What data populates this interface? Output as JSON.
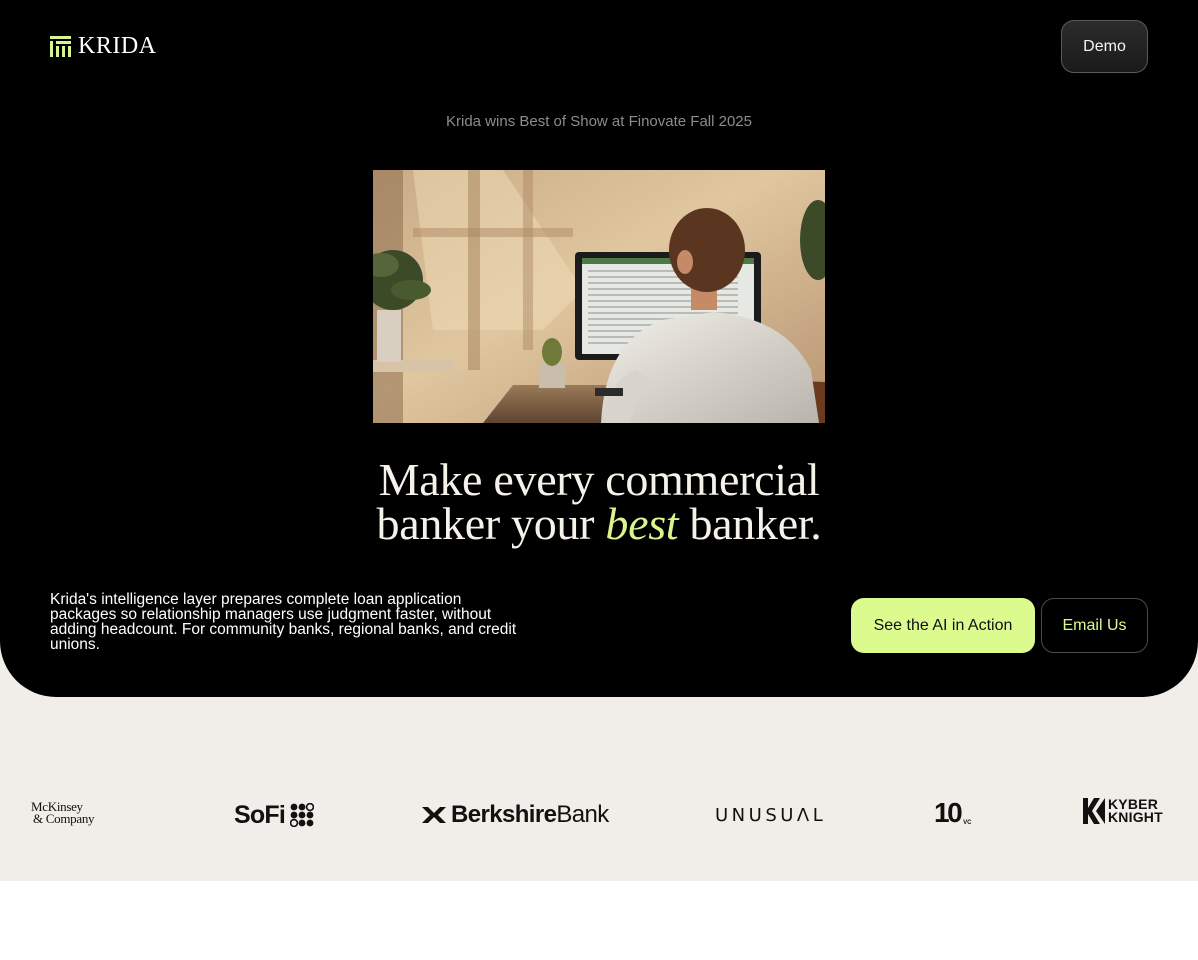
{
  "header": {
    "brand_name": "KRIDA",
    "brand_icon": "krida-logo-icon",
    "demo_label": "Demo"
  },
  "announcement": "Krida wins Best of Show at Finovate Fall 2025",
  "hero": {
    "headline_line1": "Make every commercial",
    "headline_line2_pre": "banker your ",
    "headline_accent": "best",
    "headline_line2_post": " banker.",
    "description": "Krida's intelligence layer prepares complete loan application packages so relationship managers use judgment faster, without adding headcount. For community banks, regional banks, and credit unions.",
    "primary_cta": "See the AI in Action",
    "secondary_cta": "Email Us"
  },
  "logos": {
    "mckinsey_line1": "McKinsey",
    "mckinsey_line2": "& Company",
    "sofi": "SoFi",
    "berkshire_bold": "Berkshire",
    "berkshire_light": "Bank",
    "unusual": "UNUSUΛL",
    "ten": "10",
    "ten_suffix": "VC",
    "kyber": "KYBER",
    "knight": "KNIGHT"
  },
  "colors": {
    "background_dark": "#000000",
    "accent_lime": "#dcfb8e",
    "logo_strip_bg": "#f1ede8",
    "announcement_gray": "#8c8c8c"
  }
}
